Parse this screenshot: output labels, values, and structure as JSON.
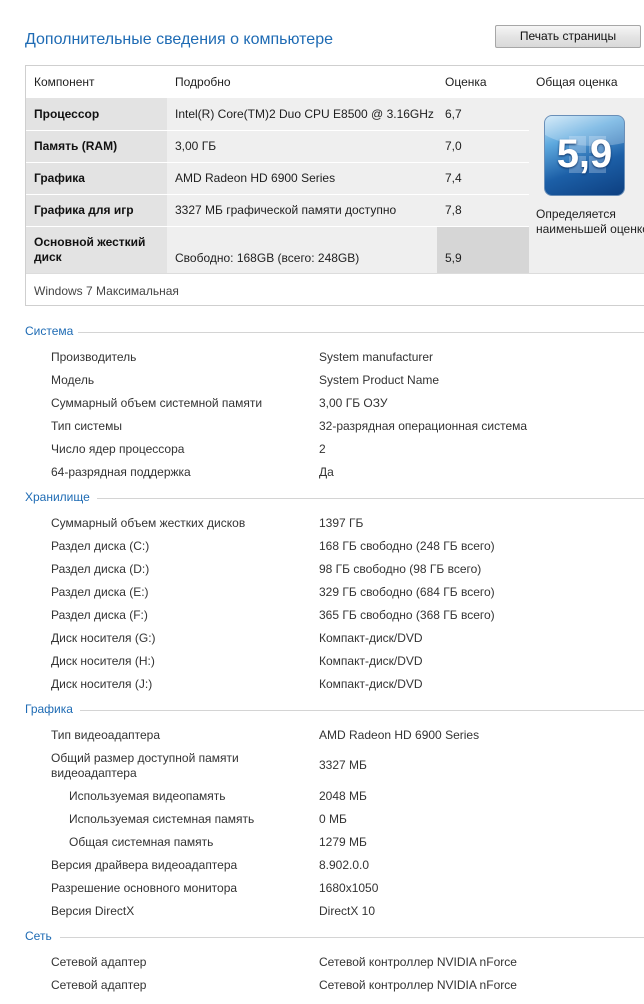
{
  "page_title": "Дополнительные сведения о компьютере",
  "print_button": "Печать страницы",
  "rating_table": {
    "headers": {
      "component": "Компонент",
      "details": "Подробно",
      "score": "Оценка",
      "base_score": "Общая оценка"
    },
    "rows": [
      {
        "component": "Процессор",
        "details": "Intel(R) Core(TM)2 Duo CPU E8500 @ 3.16GHz",
        "score": "6,7"
      },
      {
        "component": "Память (RAM)",
        "details": "3,00 ГБ",
        "score": "7,0"
      },
      {
        "component": "Графика",
        "details": "AMD Radeon HD 6900 Series",
        "score": "7,4"
      },
      {
        "component": "Графика для игр",
        "details": "3327 МБ графической памяти доступно",
        "score": "7,8"
      },
      {
        "component": "Основной жесткий диск",
        "details": "Свободно: 168GB (всего: 248GB)",
        "score": "5,9"
      }
    ],
    "base_score_value": "5,9",
    "base_score_note": "Определяется наименьшей оценкой",
    "edition": "Windows 7 Максимальная"
  },
  "sections": [
    {
      "title": "Система",
      "rows": [
        {
          "label": "Производитель",
          "value": "System manufacturer"
        },
        {
          "label": "Модель",
          "value": "System Product Name"
        },
        {
          "label": "Суммарный объем системной памяти",
          "value": "3,00 ГБ ОЗУ"
        },
        {
          "label": "Тип системы",
          "value": "32-разрядная операционная система"
        },
        {
          "label": "Число ядер процессора",
          "value": "2"
        },
        {
          "label": "64-разрядная поддержка",
          "value": "Да"
        }
      ]
    },
    {
      "title": "Хранилище",
      "rows": [
        {
          "label": "Суммарный объем жестких дисков",
          "value": "1397 ГБ"
        },
        {
          "label": "Раздел диска (C:)",
          "value": "168 ГБ свободно (248 ГБ всего)"
        },
        {
          "label": "Раздел диска (D:)",
          "value": "98 ГБ свободно (98 ГБ всего)"
        },
        {
          "label": "Раздел диска (E:)",
          "value": "329 ГБ свободно (684 ГБ всего)"
        },
        {
          "label": "Раздел диска (F:)",
          "value": "365 ГБ свободно (368 ГБ всего)"
        },
        {
          "label": "Диск носителя (G:)",
          "value": "Компакт-диск/DVD"
        },
        {
          "label": "Диск носителя (H:)",
          "value": "Компакт-диск/DVD"
        },
        {
          "label": "Диск носителя (J:)",
          "value": "Компакт-диск/DVD"
        }
      ]
    },
    {
      "title": "Графика",
      "rows": [
        {
          "label": "Тип видеоадаптера",
          "value": "AMD Radeon HD 6900 Series"
        },
        {
          "label": "Общий размер доступной памяти видеоадаптера",
          "value": "3327 МБ"
        },
        {
          "label": "Используемая видеопамять",
          "value": "2048 МБ"
        },
        {
          "label": "Используемая системная память",
          "value": "0 МБ"
        },
        {
          "label": "Общая системная память",
          "value": "1279 МБ"
        },
        {
          "label": "Версия драйвера видеоадаптера",
          "value": "8.902.0.0"
        },
        {
          "label": "Разрешение основного монитора",
          "value": "1680x1050"
        },
        {
          "label": "Версия DirectX",
          "value": "DirectX 10"
        }
      ]
    },
    {
      "title": "Сеть",
      "rows": [
        {
          "label": "Сетевой адаптер",
          "value": "Сетевой контроллер NVIDIA nForce"
        },
        {
          "label": "Сетевой адаптер",
          "value": "Сетевой контроллер NVIDIA nForce"
        }
      ]
    }
  ]
}
